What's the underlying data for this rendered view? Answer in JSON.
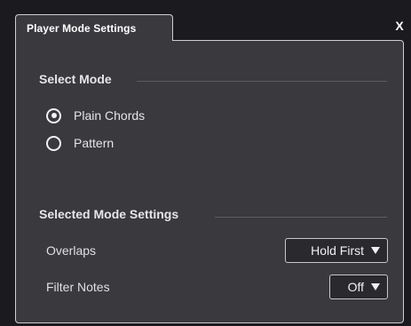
{
  "window": {
    "tab_title": "Player Mode Settings",
    "close_label": "X"
  },
  "select_mode": {
    "heading": "Select Mode",
    "options": [
      {
        "label": "Plain Chords",
        "selected": true
      },
      {
        "label": "Pattern",
        "selected": false
      }
    ]
  },
  "mode_settings": {
    "heading": "Selected Mode Settings",
    "overlaps": {
      "label": "Overlaps",
      "value": "Hold First"
    },
    "filter_notes": {
      "label": "Filter Notes",
      "value": "Off"
    }
  }
}
